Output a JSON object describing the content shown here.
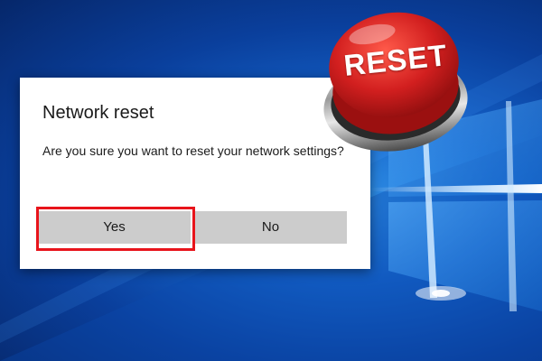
{
  "dialog": {
    "title": "Network reset",
    "message": "Are you sure you want to reset your network settings?",
    "yes_label": "Yes",
    "no_label": "No"
  },
  "graphic": {
    "reset_button_text": "RESET"
  },
  "colors": {
    "desktop_blue": "#1462c9",
    "dialog_background": "#ffffff",
    "button_gray": "#cccccc",
    "highlight_red": "#e8141b",
    "reset_button_red": "#d21f1f"
  },
  "icons": {
    "windows_logo": "windows-logo-icon",
    "reset_button": "reset-button-icon"
  }
}
